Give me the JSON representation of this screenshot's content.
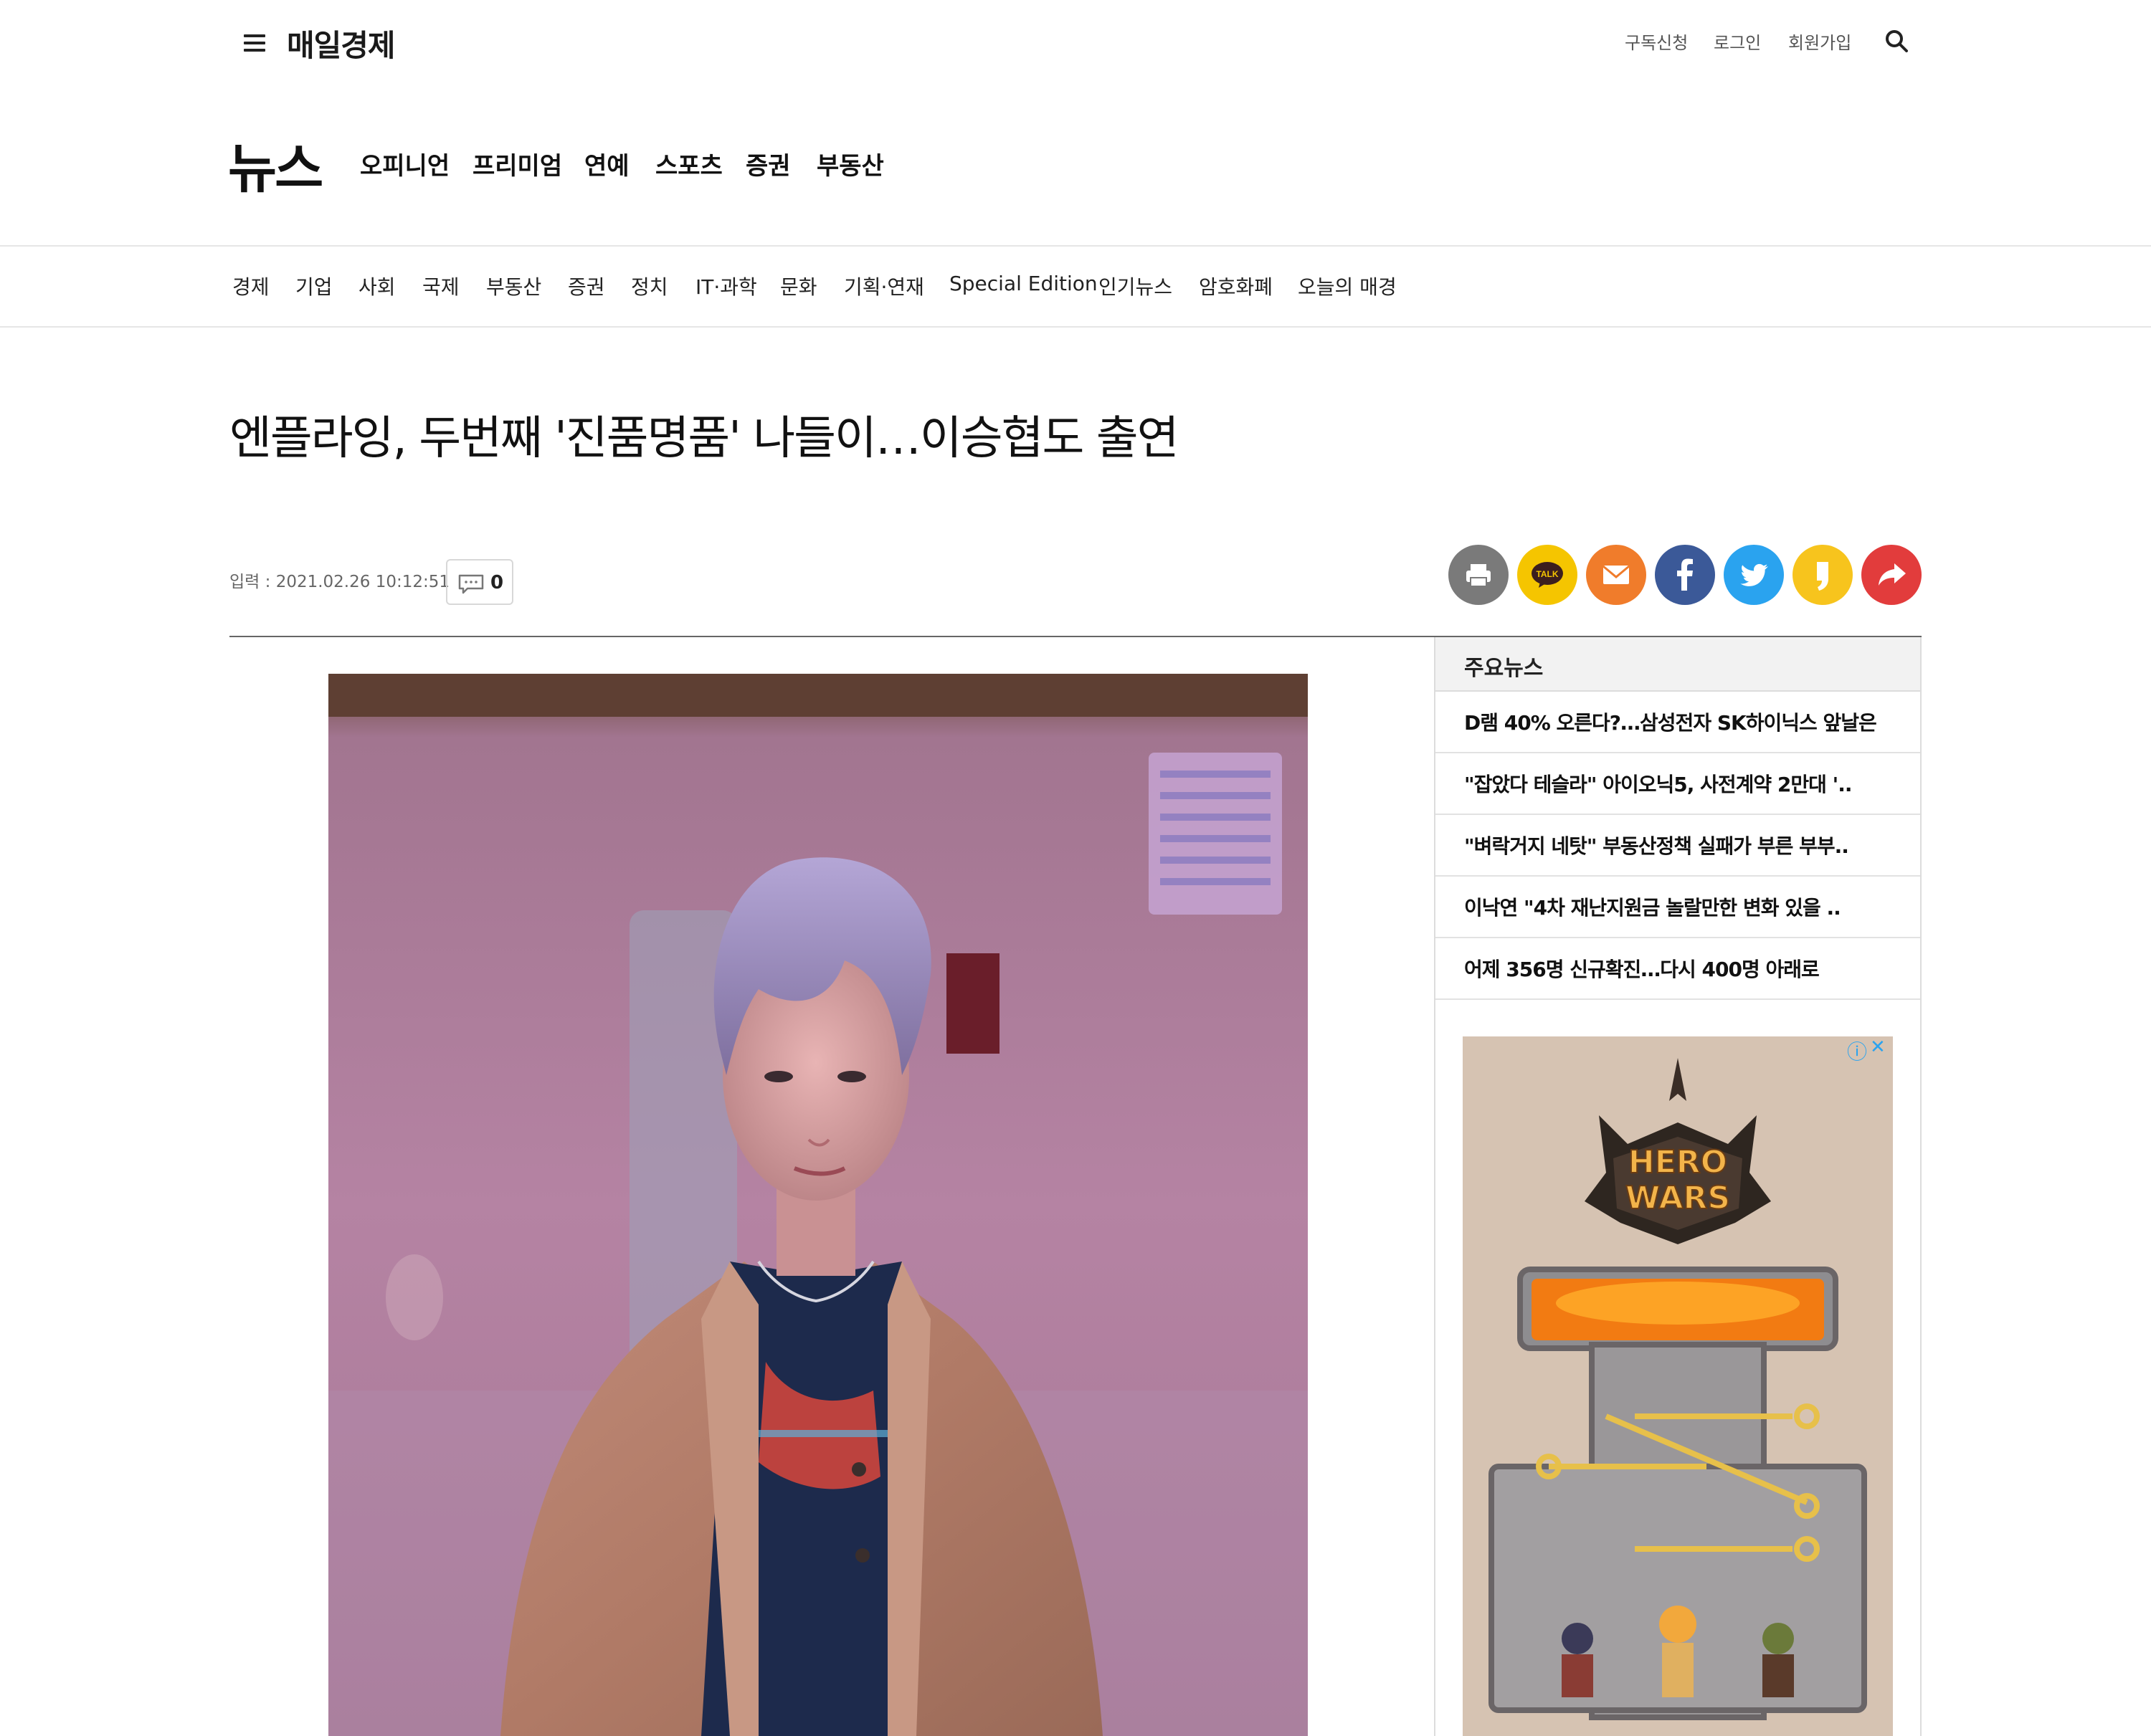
{
  "header": {
    "logo": "매일경제",
    "util_links": [
      "구독신청",
      "로그인",
      "회원가입"
    ]
  },
  "section": {
    "title": "뉴스",
    "nav": [
      "오피니언",
      "프리미엄",
      "연예",
      "스포츠",
      "증권",
      "부동산"
    ]
  },
  "subnav": [
    "경제",
    "기업",
    "사회",
    "국제",
    "부동산",
    "증권",
    "정치",
    "IT·과학",
    "문화",
    "기획·연재",
    "Special Edition",
    "인기뉴스",
    "암호화폐",
    "오늘의 매경"
  ],
  "article": {
    "headline": "엔플라잉, 두번째 '진품명품' 나들이…이승협도 출연",
    "date": "입력 : 2021.02.26 10:12:51",
    "comment_count": "0"
  },
  "share_buttons": [
    {
      "icon": "print-icon",
      "color": "#7a7a7a"
    },
    {
      "icon": "kakaotalk-icon",
      "color": "#f5c500"
    },
    {
      "icon": "email-icon",
      "color": "#f07c2b"
    },
    {
      "icon": "facebook-icon",
      "color": "#3b5998"
    },
    {
      "icon": "twitter-icon",
      "color": "#2aa3ef"
    },
    {
      "icon": "kakaostory-icon",
      "color": "#f7c41d"
    },
    {
      "icon": "share-icon",
      "color": "#e23c3c"
    }
  ],
  "sidebar": {
    "title": "주요뉴스",
    "items": [
      "D램 40% 오른다?…삼성전자 SK하이닉스 앞날은",
      "\"잡았다 테슬라\" 아이오닉5, 사전계약 2만대 '..",
      "\"벼락거지 네탓\" 부동산정책 실패가 부른 부부..",
      "이낙연 \"4차 재난지원금 놀랄만한 변화 있을 ..",
      "어제 356명 신규확진…다시 400명 아래로"
    ]
  },
  "ad": {
    "logo_line1": "HERO",
    "logo_line2": "WARS",
    "info_icon": "ⓘ",
    "close_icon": "✕"
  }
}
